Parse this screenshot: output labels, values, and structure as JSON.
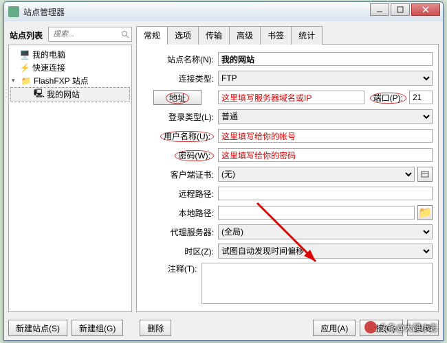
{
  "window": {
    "title": "站点管理器"
  },
  "winbtns": {
    "min": "minimize",
    "max": "maximize",
    "close": "close"
  },
  "sidebar": {
    "title": "站点列表",
    "searchPlaceholder": "搜索...",
    "items": [
      {
        "label": "我的电脑",
        "icon": "computer"
      },
      {
        "label": "快速连接",
        "icon": "bolt"
      },
      {
        "label": "FlashFXP 站点",
        "icon": "folder",
        "expanded": true
      },
      {
        "label": "我的网站",
        "icon": "site",
        "selected": true
      }
    ]
  },
  "tabs": [
    "常规",
    "选项",
    "传输",
    "高级",
    "书签",
    "统计"
  ],
  "activeTab": 0,
  "form": {
    "siteNameLabel": "站点名称(N):",
    "siteName": "我的网站",
    "connTypeLabel": "连接类型:",
    "connType": "FTP",
    "addrBtn": "地址",
    "addrValue": "这里填写服务器域名或IP",
    "portLabel": "端口(P):",
    "port": "21",
    "loginTypeLabel": "登录类型(L):",
    "loginType": "普通",
    "userLabel": "用户名称(U):",
    "userValue": "这里填写给你的帐号",
    "passLabel": "密码(W):",
    "passValue": "这里填写给你的密码",
    "certLabel": "客户端证书:",
    "certValue": "(无)",
    "remoteLabel": "远程路径:",
    "remoteValue": "",
    "localLabel": "本地路径:",
    "localValue": "",
    "proxyLabel": "代理服务器:",
    "proxyValue": "(全局)",
    "tzLabel": "时区(Z):",
    "tzValue": "试图自动发现时间偏移",
    "notesLabel": "注释(T):",
    "notesValue": ""
  },
  "footer": {
    "newSite": "新建站点(S)",
    "newGroup": "新建组(G)",
    "delete": "删除",
    "apply": "应用(A)",
    "connect": "连接(C)",
    "close": "关闭"
  },
  "watermark": "头条@大超小志",
  "colors": {
    "annotation": "#d00"
  }
}
